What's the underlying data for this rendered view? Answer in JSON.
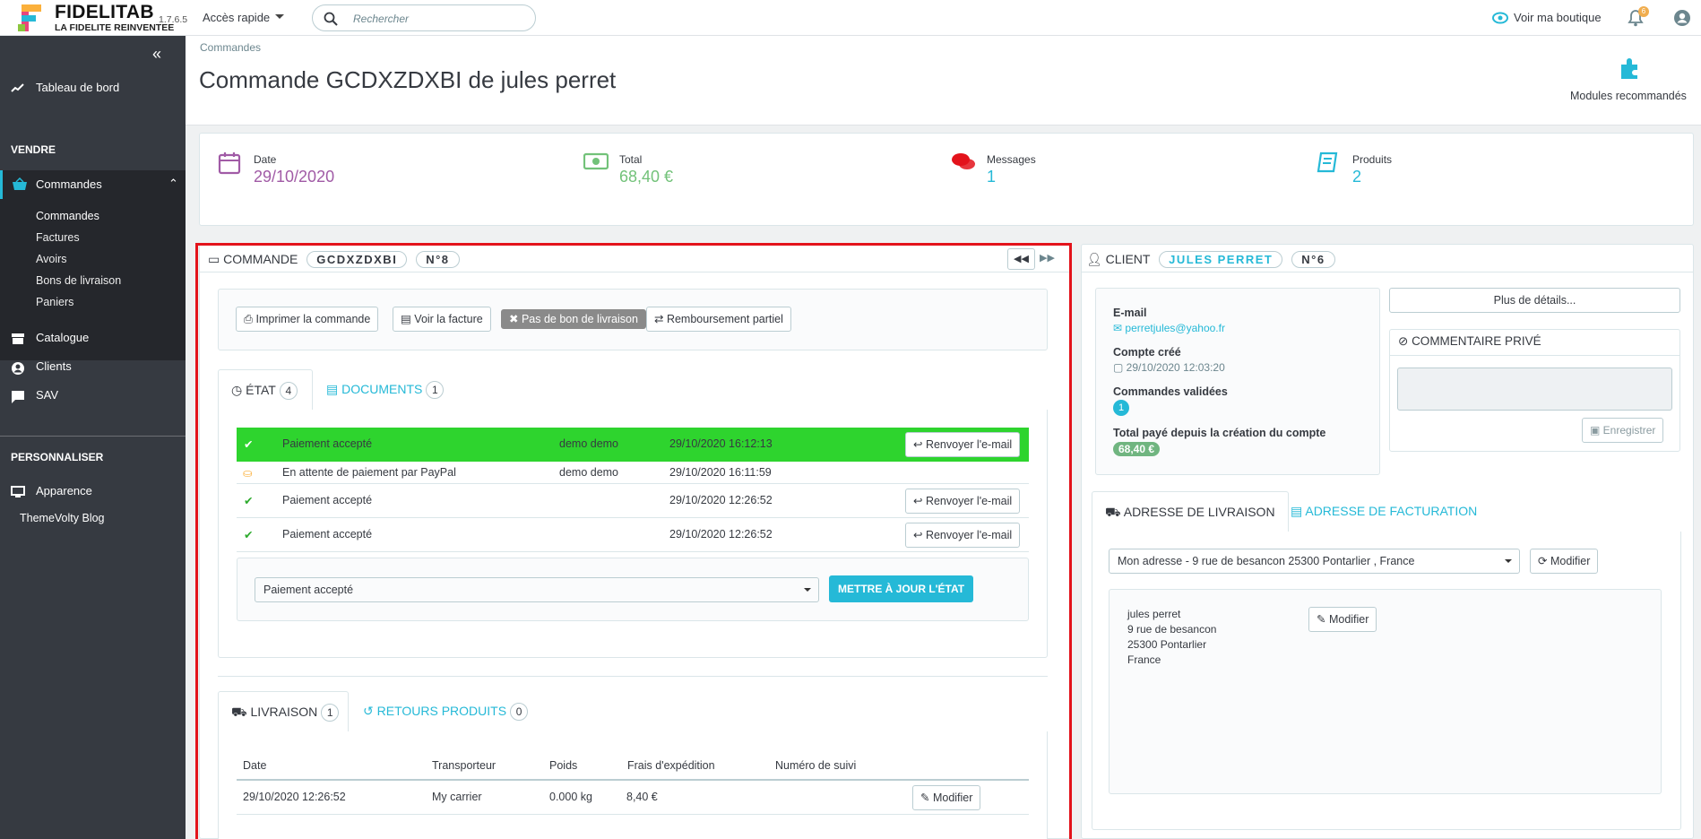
{
  "header": {
    "brand": "FIDELITAB",
    "tagline": "LA FIDELITE REINVENTEE",
    "version": "1.7.6.5",
    "quick_access": "Accès rapide",
    "search_placeholder": "Rechercher",
    "view_shop": "Voir ma boutique",
    "notif_count": "6"
  },
  "sidebar": {
    "dashboard": "Tableau de bord",
    "sell_section": "VENDRE",
    "orders": "Commandes",
    "orders_sub": [
      "Commandes",
      "Factures",
      "Avoirs",
      "Bons de livraison",
      "Paniers"
    ],
    "catalog": "Catalogue",
    "customers": "Clients",
    "support": "SAV",
    "custom_section": "PERSONNALISER",
    "appearance": "Apparence",
    "blog": "ThemeVolty Blog"
  },
  "page": {
    "breadcrumb": "Commandes",
    "title": "Commande GCDXZDXBI de jules perret",
    "modules": "Modules recommandés"
  },
  "kpis": [
    {
      "label": "Date",
      "value": "29/10/2020",
      "color": "#a15ba6"
    },
    {
      "label": "Total",
      "value": "68,40 €",
      "color": "#72c279"
    },
    {
      "label": "Messages",
      "value": "1",
      "color": "#25b9d7"
    },
    {
      "label": "Produits",
      "value": "2",
      "color": "#25b9d7"
    }
  ],
  "order": {
    "heading": "COMMANDE",
    "ref": "GCDXZDXBI",
    "number": "N°8",
    "actions": {
      "print": "Imprimer la commande",
      "invoice": "Voir la facture",
      "no_delivery": "Pas de bon de livraison",
      "refund": "Remboursement partiel"
    },
    "tabs": {
      "status": "ÉTAT",
      "status_count": "4",
      "documents": "DOCUMENTS",
      "documents_count": "1"
    },
    "history": [
      {
        "status": "Paiement accepté",
        "employee": "demo demo",
        "date": "29/10/2020 16:12:13",
        "action": "Renvoyer l'e-mail"
      },
      {
        "status": "En attente de paiement par PayPal",
        "employee": "demo demo",
        "date": "29/10/2020 16:11:59",
        "action": ""
      },
      {
        "status": "Paiement accepté",
        "employee": "",
        "date": "29/10/2020 12:26:52",
        "action": "Renvoyer l'e-mail"
      },
      {
        "status": "Paiement accepté",
        "employee": "",
        "date": "29/10/2020 12:26:52",
        "action": "Renvoyer l'e-mail"
      }
    ],
    "status_select": "Paiement accepté",
    "update_button": "METTRE À JOUR L'ÉTAT",
    "ship_tabs": {
      "delivery": "LIVRAISON",
      "delivery_count": "1",
      "returns": "RETOURS PRODUITS",
      "returns_count": "0"
    },
    "ship_headers": [
      "Date",
      "Transporteur",
      "Poids",
      "Frais d'expédition",
      "Numéro de suivi"
    ],
    "ship_row": {
      "date": "29/10/2020 12:26:52",
      "carrier": "My carrier",
      "weight": "0.000 kg",
      "cost": "8,40 €",
      "tracking": "",
      "action": "Modifier"
    }
  },
  "client": {
    "heading": "CLIENT",
    "name": "JULES PERRET",
    "number": "N°6",
    "email_label": "E-mail",
    "email": "perretjules@yahoo.fr",
    "created_label": "Compte créé",
    "created": "29/10/2020 12:03:20",
    "validated_label": "Commandes validées",
    "validated": "1",
    "total_label": "Total payé depuis la création du compte",
    "total": "68,40 €",
    "details_button": "Plus de détails...",
    "private_comment": "COMMENTAIRE PRIVÉ",
    "save_button": "Enregistrer"
  },
  "address": {
    "tab_delivery": "ADRESSE DE LIVRAISON",
    "tab_invoice": "ADRESSE DE FACTURATION",
    "selected": "Mon adresse - 9 rue de besancon 25300 Pontarlier , France",
    "modify": "Modifier",
    "lines": [
      "jules perret",
      "9 rue de besancon",
      "25300 Pontarlier",
      "France"
    ],
    "modify2": "Modifier"
  }
}
